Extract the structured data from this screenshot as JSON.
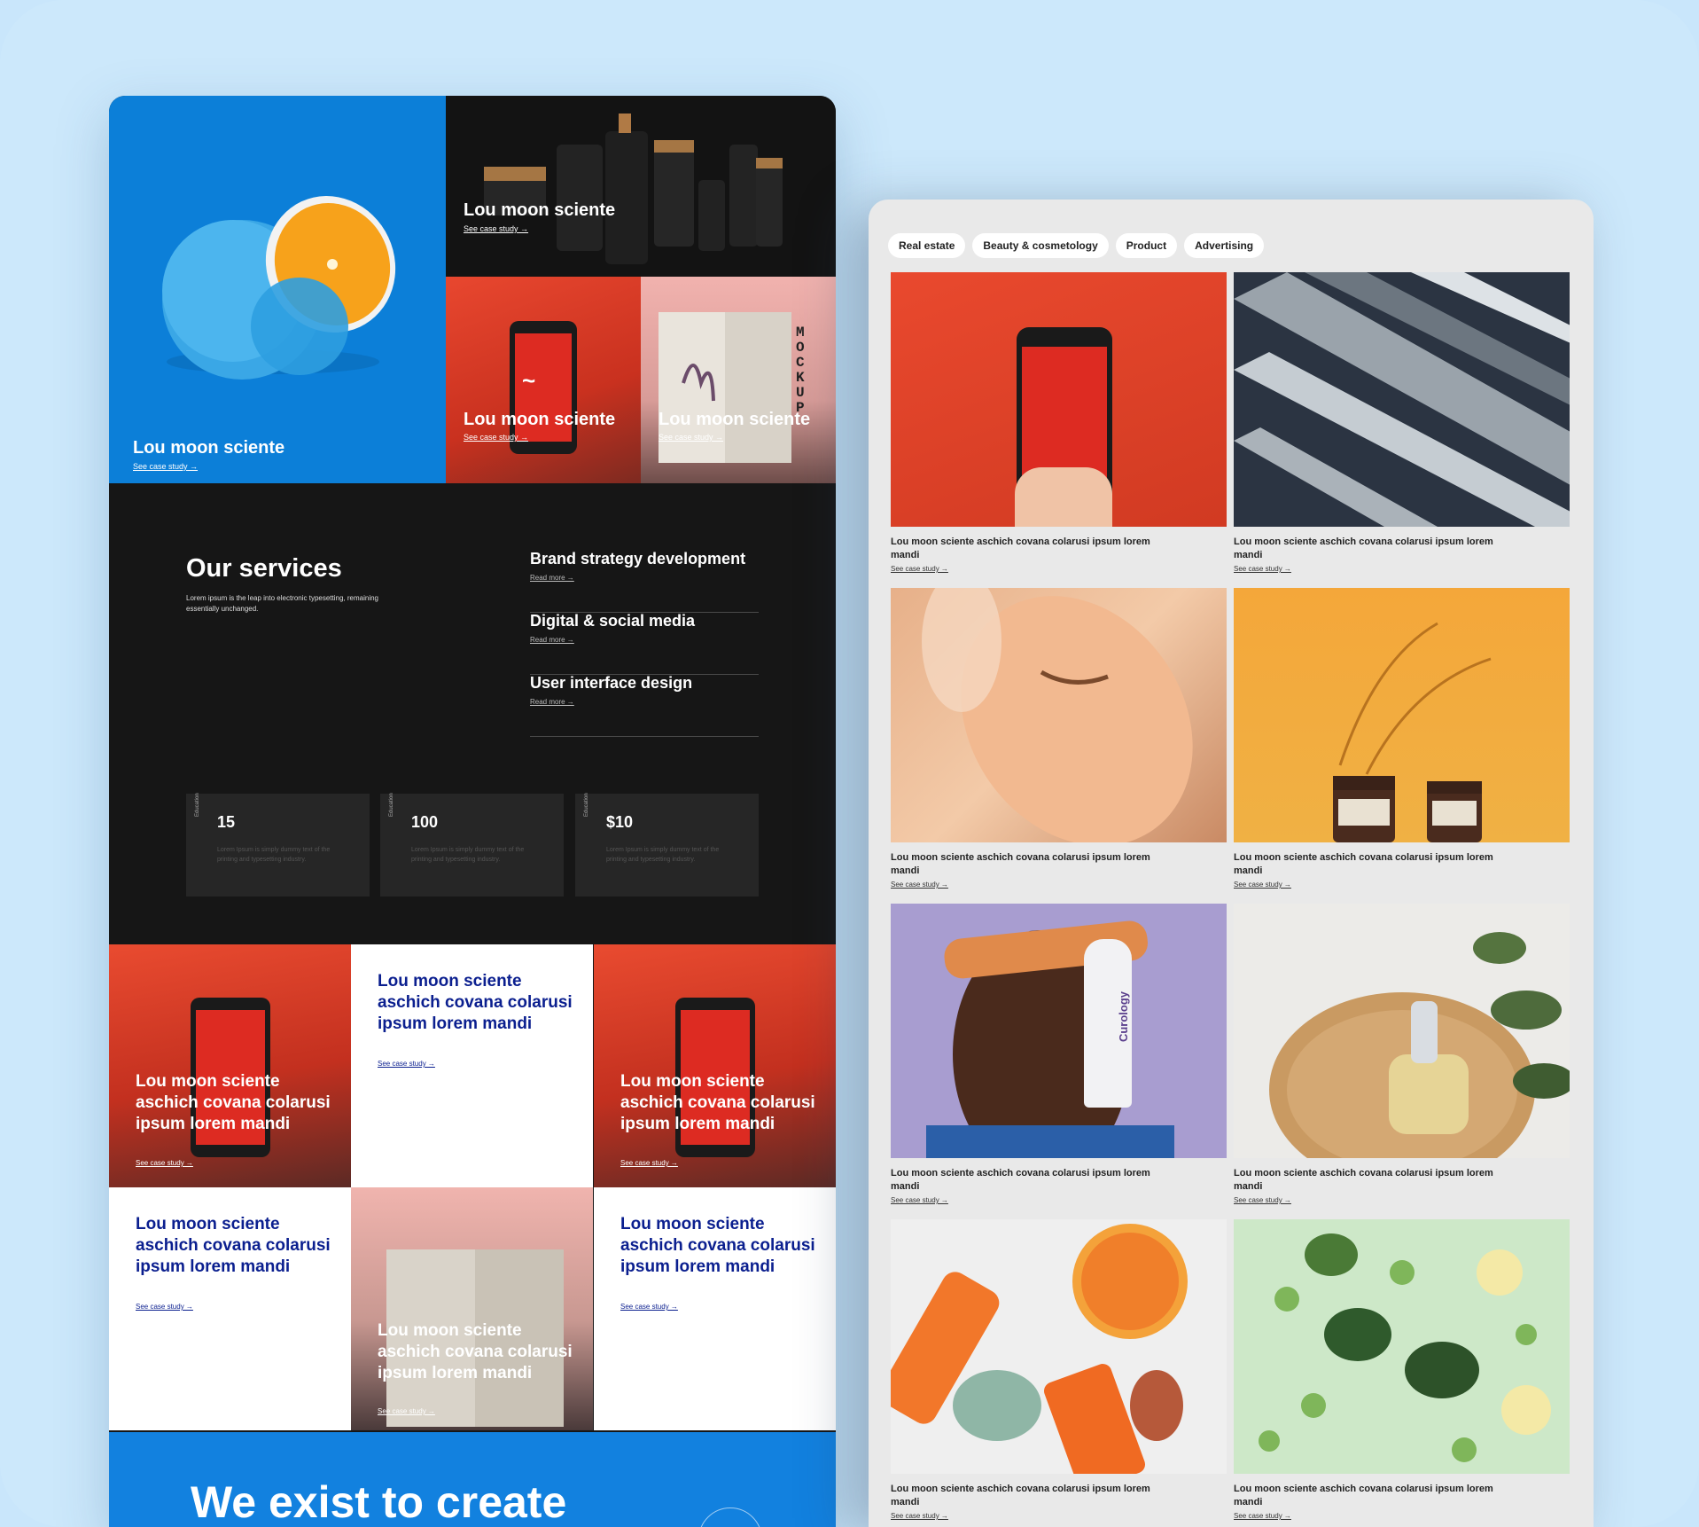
{
  "left": {
    "hero": [
      {
        "title": "Lou moon sciente",
        "link": "See case study →"
      },
      {
        "title": "Lou moon sciente",
        "link": "See case study →"
      },
      {
        "title": "Lou moon sciente",
        "link": "See case study →"
      },
      {
        "title": "Lou moon sciente",
        "link": "See case study →"
      }
    ],
    "mockup_text": "MOCKUP",
    "services": {
      "heading": "Our services",
      "description": "Lorem ipsum is the leap into electronic typesetting, remaining essentially unchanged.",
      "items": [
        {
          "title": "Brand strategy development",
          "link": "Read more →"
        },
        {
          "title": "Digital & social media",
          "link": "Read more →"
        },
        {
          "title": "User interface design",
          "link": "Read more →"
        }
      ],
      "stats": [
        {
          "category": "Education",
          "value": "15",
          "desc": "Lorem Ipsum is simply dummy text of the printing and typesetting industry."
        },
        {
          "category": "Education",
          "value": "100",
          "desc": "Lorem Ipsum is simply dummy text of the printing and typesetting industry."
        },
        {
          "category": "Education",
          "value": "$10",
          "desc": "Lorem Ipsum is simply dummy text of the printing and typesetting industry."
        }
      ]
    },
    "grid": [
      {
        "title": "Lou moon sciente aschich covana colarusi ipsum lorem mandi",
        "link": "See case study →"
      },
      {
        "title": "Lou moon sciente aschich covana colarusi ipsum lorem mandi",
        "link": "See case study →"
      },
      {
        "title": "Lou moon sciente aschich covana colarusi ipsum lorem mandi",
        "link": "See case study →"
      },
      {
        "title": "Lou moon sciente aschich covana colarusi ipsum lorem mandi",
        "link": "See case study →"
      },
      {
        "title": "Lou moon sciente aschich covana colarusi ipsum lorem mandi",
        "link": "See case study →"
      },
      {
        "title": "Lou moon sciente aschich covana colarusi ipsum lorem mandi",
        "link": "See case study →"
      }
    ],
    "banner": "We exist to create"
  },
  "right": {
    "filters": [
      "Real estate",
      "Beauty & cosmetology",
      "Product",
      "Advertising"
    ],
    "cards": [
      {
        "caption": "Lou moon sciente aschich covana colarusi ipsum lorem mandi",
        "link": "See case study →"
      },
      {
        "caption": "Lou moon sciente aschich covana colarusi ipsum lorem mandi",
        "link": "See case study →"
      },
      {
        "caption": "Lou moon sciente aschich covana colarusi ipsum lorem mandi",
        "link": "See case study →"
      },
      {
        "caption": "Lou moon sciente aschich covana colarusi ipsum lorem mandi",
        "link": "See case study →"
      },
      {
        "caption": "Lou moon sciente aschich covana colarusi ipsum lorem mandi",
        "link": "See case study →"
      },
      {
        "caption": "Lou moon sciente aschich covana colarusi ipsum lorem mandi",
        "link": "See case study →"
      },
      {
        "caption": "Lou moon sciente aschich covana colarusi ipsum lorem mandi",
        "link": "See case study →"
      },
      {
        "caption": "Lou moon sciente aschich covana colarusi ipsum lorem mandi",
        "link": "See case study →"
      }
    ],
    "product_label": "Curology"
  },
  "colors": {
    "background": "#cce8fb",
    "brand_blue": "#1281df",
    "dark": "#161616",
    "navy_text": "#0b1f8f"
  }
}
